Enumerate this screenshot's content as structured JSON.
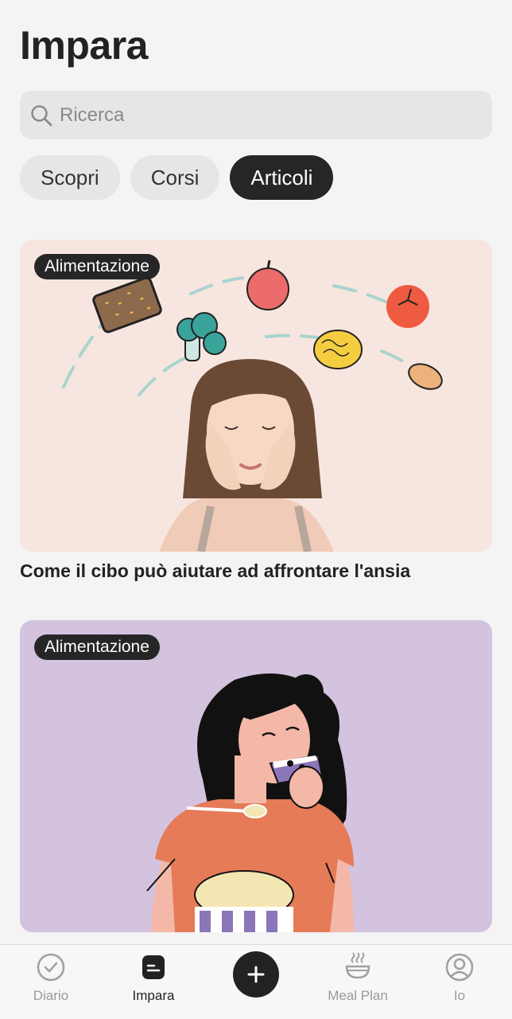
{
  "header": {
    "title": "Impara"
  },
  "search": {
    "placeholder": "Ricerca",
    "icon": "search-icon"
  },
  "tabs": [
    {
      "label": "Scopri",
      "active": false
    },
    {
      "label": "Corsi",
      "active": false
    },
    {
      "label": "Articoli",
      "active": true
    }
  ],
  "articles": [
    {
      "badge": "Alimentazione",
      "title": "Come il cibo può aiutare ad affrontare l'ansia",
      "bg": "#f7e6df"
    },
    {
      "badge": "Alimentazione",
      "title": "",
      "bg": "#d3c3de"
    }
  ],
  "bottom_nav": {
    "items": [
      {
        "label": "Diario",
        "icon": "check-circle-icon",
        "active": false
      },
      {
        "label": "Impara",
        "icon": "book-icon",
        "active": true
      },
      {
        "label": "",
        "icon": "plus-icon",
        "active": false
      },
      {
        "label": "Meal Plan",
        "icon": "bowl-icon",
        "active": false
      },
      {
        "label": "Io",
        "icon": "user-icon",
        "active": false
      }
    ]
  },
  "colors": {
    "active_tab": "#262626",
    "background": "#f4f4f4"
  }
}
